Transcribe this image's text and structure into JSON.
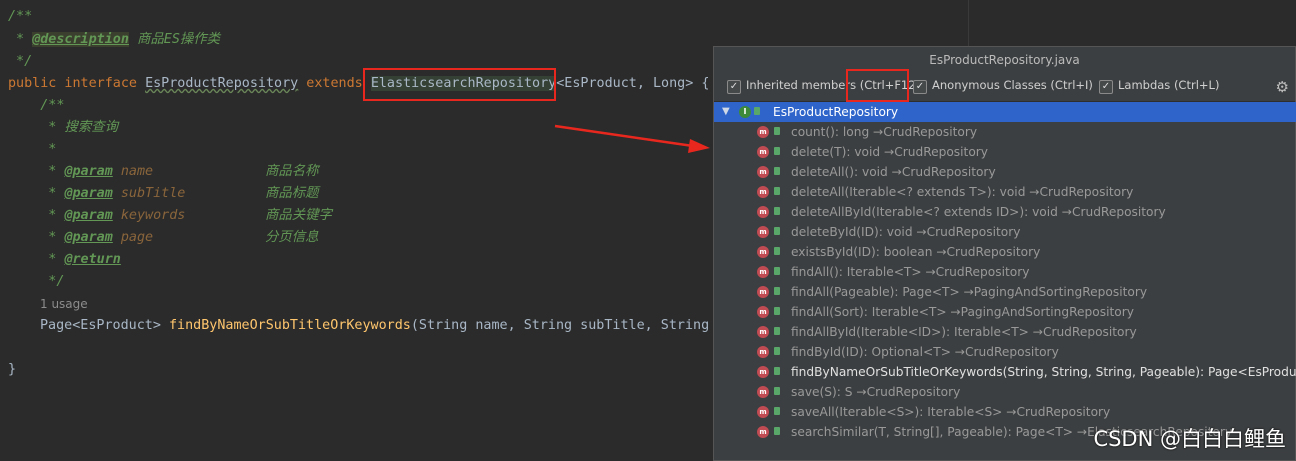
{
  "editor": {
    "lines": {
      "l1": "/**",
      "l2_star": " * ",
      "l2_tag": "@description",
      "l2_text": " 商品ES操作类",
      "l3": " */",
      "l4_kw1": "public interface ",
      "l4_name": "EsProductRepository",
      "l4_kw2": " extends ",
      "l4_parent": "ElasticsearchRepository",
      "l4_rest": "<EsProduct, Long> {",
      "l5": "    /**",
      "l6": "     * 搜索查询",
      "l7": "     *",
      "l8_tag": "@param",
      "l8_name": "name",
      "l8_desc": "商品名称",
      "l9_tag": "@param",
      "l9_name": "subTitle",
      "l9_desc": "商品标题",
      "l10_tag": "@param",
      "l10_name": "keywords",
      "l10_desc": "商品关键字",
      "l11_tag": "@param",
      "l11_name": "page",
      "l11_desc": "分页信息",
      "l12_tag": "@return",
      "l13": "     */",
      "l15_type": "Page<EsProduct> ",
      "l15_fn": "findByNameOrSubTitleOrKeywords",
      "l15_rest": "(String name, String subTitle, String",
      "l17": "}"
    },
    "usage": "1 usage"
  },
  "popup": {
    "title": "EsProductRepository.java",
    "options": [
      {
        "label": "Inherited members (Ctrl+F12)",
        "checked": true
      },
      {
        "label": "Anonymous Classes (Ctrl+I)",
        "checked": true
      },
      {
        "label": "Lambdas (Ctrl+L)",
        "checked": true
      }
    ],
    "settings_icon": "gear-icon",
    "root": "EsProductRepository",
    "members": [
      "count(): long →CrudRepository",
      "delete(T): void →CrudRepository",
      "deleteAll(): void →CrudRepository",
      "deleteAll(Iterable<? extends T>): void →CrudRepository",
      "deleteAllById(Iterable<? extends ID>): void →CrudRepository",
      "deleteById(ID): void →CrudRepository",
      "existsById(ID): boolean →CrudRepository",
      "findAll(): Iterable<T> →CrudRepository",
      "findAll(Pageable): Page<T> →PagingAndSortingRepository",
      "findAll(Sort): Iterable<T> →PagingAndSortingRepository",
      "findAllById(Iterable<ID>): Iterable<T> →CrudRepository",
      "findById(ID): Optional<T> →CrudRepository",
      "findByNameOrSubTitleOrKeywords(String, String, String, Pageable): Page<EsProduct>",
      "save(S): S →CrudRepository",
      "saveAll(Iterable<S>): Iterable<S> →CrudRepository",
      "searchSimilar(T, String[], Pageable): Page<T> →ElasticsearchRepository"
    ]
  },
  "watermark": "CSDN @白白白鲤鱼",
  "colors": {
    "annotation_red": "#e8281e",
    "selection": "#2f65ca"
  }
}
